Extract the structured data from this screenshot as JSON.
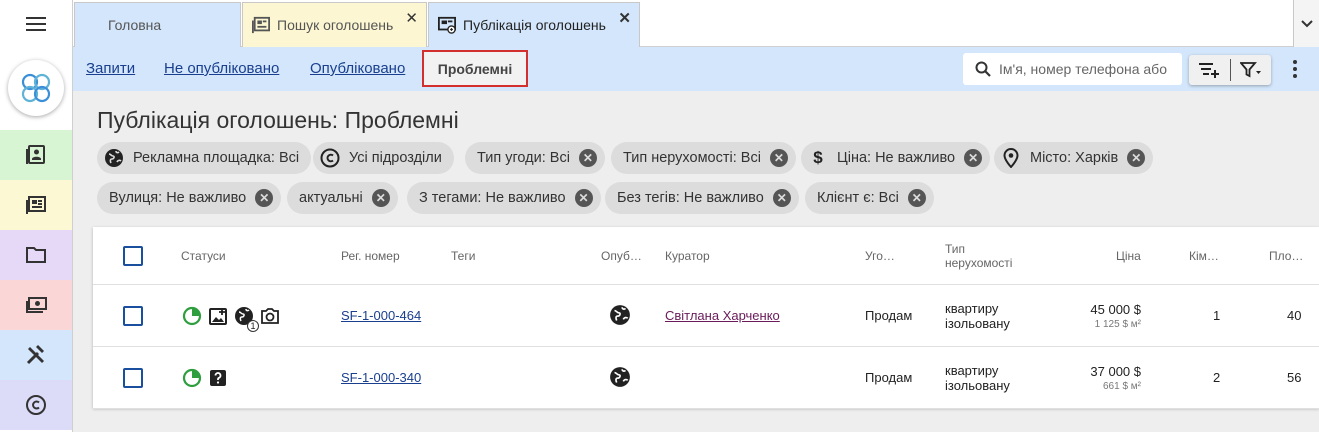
{
  "tabs": {
    "home": "Головна",
    "search": "Пошук оголошень",
    "publication": "Публікація оголошень",
    "close_glyph": "✕"
  },
  "subnav": {
    "requests": "Запити",
    "unpublished": "Не опубліковано",
    "published": "Опубліковано",
    "problematic": "Проблемні"
  },
  "search": {
    "placeholder": "Ім'я, номер телефона або"
  },
  "page": {
    "title": "Публікація оголошень: Проблемні"
  },
  "chips": {
    "platform": "Рекламна площадка: Всі",
    "divisions": "Усі підрозділи",
    "deal_type": "Тип угоди: Всі",
    "property_type": "Тип нерухомості: Всі",
    "price": "Ціна: Не важливо",
    "city": "Місто: Харків",
    "street": "Вулиця: Не важливо",
    "actual": "актуальні",
    "with_tags": "З тегами: Не важливо",
    "without_tags": "Без тегів: Не важливо",
    "client": "Клієнт є: Всі",
    "close_glyph": "✕",
    "dollar_glyph": "$"
  },
  "table": {
    "headers": {
      "statuses": "Статуси",
      "reg_number": "Рег. номер",
      "tags": "Теги",
      "published": "Опуб…",
      "curator": "Куратор",
      "deal": "Уго…",
      "property_type_1": "Тип",
      "property_type_2": "нерухомості",
      "price": "Ціна",
      "rooms": "Кім…",
      "area": "Пло…"
    },
    "rows": [
      {
        "reg": "SF-1-000-464",
        "curator": "Світлана Харченко",
        "deal": "Продам",
        "type_1": "квартиру",
        "type_2": "ізольовану",
        "price": "45 000 $",
        "price_m2": "1 125 $ м²",
        "rooms": "1",
        "area": "40",
        "badge": "1",
        "status_icons": [
          "pie-clock-icon",
          "photo-plus-icon",
          "globe-icon",
          "camera-icon"
        ]
      },
      {
        "reg": "SF-1-000-340",
        "curator": "",
        "deal": "Продам",
        "type_1": "квартиру",
        "type_2": "ізольовану",
        "price": "37 000 $",
        "price_m2": "661 $ м²",
        "rooms": "2",
        "area": "56",
        "status_icons": [
          "pie-clock-icon",
          "question-icon"
        ]
      }
    ]
  },
  "colors": {
    "accent_blue": "#d3e6fb",
    "search_tab": "#fcf7d2",
    "active_outline": "#d32f2f",
    "status_green": "#2e9e3e",
    "rail_green": "#d7f5d3",
    "rail_yellow": "#fbf8d3",
    "rail_purple": "#e6d8f7",
    "rail_pink": "#fbd6d6",
    "rail_blue": "#d3e6fb",
    "rail_lavender": "#dcdcf8"
  },
  "rail": {
    "icons": [
      "contacts-icon",
      "listings-icon",
      "folder-icon",
      "money-icon",
      "tools-icon",
      "copyright-icon"
    ]
  }
}
